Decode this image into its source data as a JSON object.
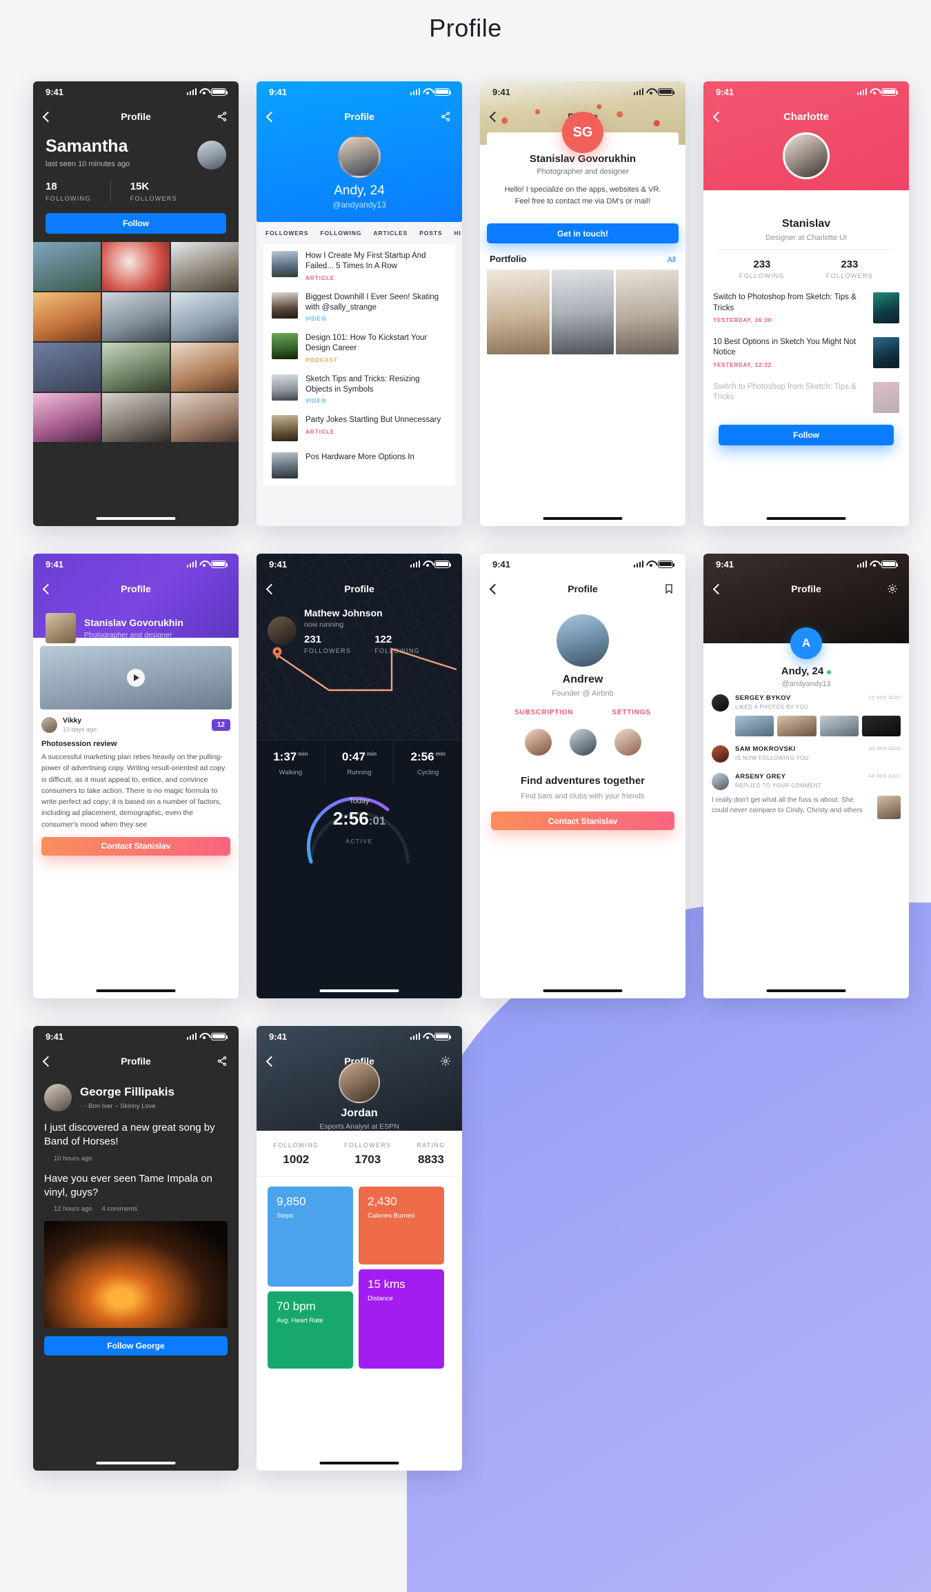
{
  "page": {
    "title": "Profile"
  },
  "status_bar": {
    "time": "9:41"
  },
  "screens": {
    "samantha": {
      "nav_title": "Profile",
      "name": "Samantha",
      "last_seen": "last seen 10 minutes ago",
      "stats": [
        {
          "value": "18",
          "label": "FOLLOWING"
        },
        {
          "value": "15K",
          "label": "FOLLOWERS"
        }
      ],
      "follow_button": "Follow"
    },
    "andy_blue": {
      "nav_title": "Profile",
      "name": "Andy, 24",
      "username": "@andyandy13",
      "tabs": [
        "FOLLOWERS",
        "FOLLOWING",
        "ARTICLES",
        "POSTS",
        "HI"
      ],
      "articles": [
        {
          "title": "How I Create My First Startup And Failed... 5 Times In A Row",
          "tag": "ARTICLE",
          "tag_color": "#f3566e"
        },
        {
          "title": "Biggest Downhill I Ever Seen! Skating with @sally_strange",
          "tag": "VIDEO",
          "tag_color": "#5eb8f5"
        },
        {
          "title": "Design 101: How To Kickstart Your Design Career",
          "tag": "PODCAST",
          "tag_color": "#f3a14e"
        },
        {
          "title": "Sketch Tips and Tricks: Resizing Objects in Symbols",
          "tag": "VIDEO",
          "tag_color": "#5eb8f5"
        },
        {
          "title": "Party Jokes Startling But Unnecessary",
          "tag": "ARTICLE",
          "tag_color": "#f3566e"
        },
        {
          "title": "Pos Hardware More Options In",
          "tag": "",
          "tag_color": "#f3566e"
        }
      ]
    },
    "stanislav_sg": {
      "nav_title": "Profile",
      "monogram": "SG",
      "name": "Stanislav Govorukhin",
      "role": "Photographer and designer",
      "bio": "Hello! I specialize on the apps, websites & VR. Feel free to contact me via DM's or mail!",
      "cta": "Get in touch!",
      "portfolio_label": "Portfolio",
      "portfolio_all": "All"
    },
    "charlotte": {
      "nav_title": "Charlotte",
      "name": "Stanislav",
      "role": "Designer at Charlotte UI",
      "stats": [
        {
          "value": "233",
          "label": "FOLLOWING"
        },
        {
          "value": "233",
          "label": "FOLLOWERS"
        }
      ],
      "news": [
        {
          "title": "Switch to Photoshop from Sketch: Tips & Tricks",
          "time": "YESTERDAY, 16:30"
        },
        {
          "title": "10 Best Options in Sketch You Might Not Notice",
          "time": "YESTERDAY, 12:22"
        },
        {
          "title": "Switch to Photoshop from Sketch: Tips & Tricks",
          "time": ""
        }
      ],
      "follow_button": "Follow"
    },
    "stanislav_purple": {
      "nav_title": "Profile",
      "name": "Stanislav Govorukhin",
      "role": "Photographer and designer",
      "commenter": "Vikky",
      "commenter_time": "10 days ago",
      "badge": "12",
      "post_title": "Photosession review",
      "post_body": "A successful marketing plan relies heavily on the pulling-power of advertising copy. Writing result-oriented ad copy is difficult, as it must appeal to, entice, and convince consumers to take action. There is no magic formula to write perfect ad copy; it is based on a number of factors, including ad placement, demographic, even the consumer's mood when they see",
      "cta": "Contact Stanislav"
    },
    "mathew": {
      "nav_title": "Profile",
      "name": "Mathew Johnson",
      "status": "now running",
      "stats": [
        {
          "value": "231",
          "label": "FOLLOWERS"
        },
        {
          "value": "122",
          "label": "FOLLOWING"
        }
      ],
      "activities": [
        {
          "value": "1:37",
          "unit": "min",
          "label": "Walking"
        },
        {
          "value": "0:47",
          "unit": "min",
          "label": "Running"
        },
        {
          "value": "2:56",
          "unit": "min",
          "label": "Cycling"
        }
      ],
      "today_label": "Today",
      "today_value": "2:56",
      "today_seconds": ":01",
      "active_label": "ACTIVE"
    },
    "andrew": {
      "nav_title": "Profile",
      "name": "Andrew",
      "role": "Founder @ Airbnb",
      "tabs": [
        "SUBSCRIPTION",
        "SETTINGS"
      ],
      "headline": "Find adventures together",
      "subline": "Find bars and clubs with your friends",
      "cta": "Contact Stanislav"
    },
    "andy_dark": {
      "nav_title": "Profile",
      "monogram": "A",
      "name": "Andy, 24",
      "username": "@andyandy13",
      "feed": [
        {
          "name": "SERGEY BYKOV",
          "action": "LIKED 4 PHOTOS BY YOU",
          "time": "15 MIN AGO",
          "type": "photos"
        },
        {
          "name": "SAM MOKROVSKI",
          "action": "IS NOW FOLLOWING YOU",
          "time": "30 MIN AGO",
          "type": "plain"
        },
        {
          "name": "ARSENY GREY",
          "action": "REPLIED TO YOUR COMMENT",
          "time": "48 MIN AGO",
          "type": "comment",
          "comment": "I really don't get what all the fuss is about. She could never compare to Cindy, Christy and others"
        }
      ]
    },
    "george": {
      "nav_title": "Profile",
      "name": "George Fillipakis",
      "song": "···  Bon Iver – Skinny Love",
      "posts": [
        {
          "text": "I just discovered a new great song by Band of Horses!",
          "time": "10 hours ago",
          "comments": ""
        },
        {
          "text": "Have you ever seen Tame Impala on vinyl, guys?",
          "time": "12 hours ago",
          "comments": "4 comments"
        }
      ],
      "follow_button": "Follow George"
    },
    "jordan": {
      "nav_title": "Profile",
      "name": "Jordan",
      "role": "Esports Analyst at ESPN",
      "stats": [
        {
          "label": "FOLLOWING",
          "value": "1002"
        },
        {
          "label": "FOLLOWERS",
          "value": "1703"
        },
        {
          "label": "RATING",
          "value": "8833"
        }
      ],
      "tiles": [
        {
          "value": "9,850",
          "label": "Steps",
          "color": "#4aa3ec"
        },
        {
          "value": "2,430",
          "label": "Calories Burned",
          "color": "#ee6b48"
        },
        {
          "value": "70 bpm",
          "label": "Avg. Heart Rate",
          "color": "#16a86d"
        },
        {
          "value": "15 kms",
          "label": "Distance",
          "color": "#a21ef0"
        }
      ]
    }
  }
}
